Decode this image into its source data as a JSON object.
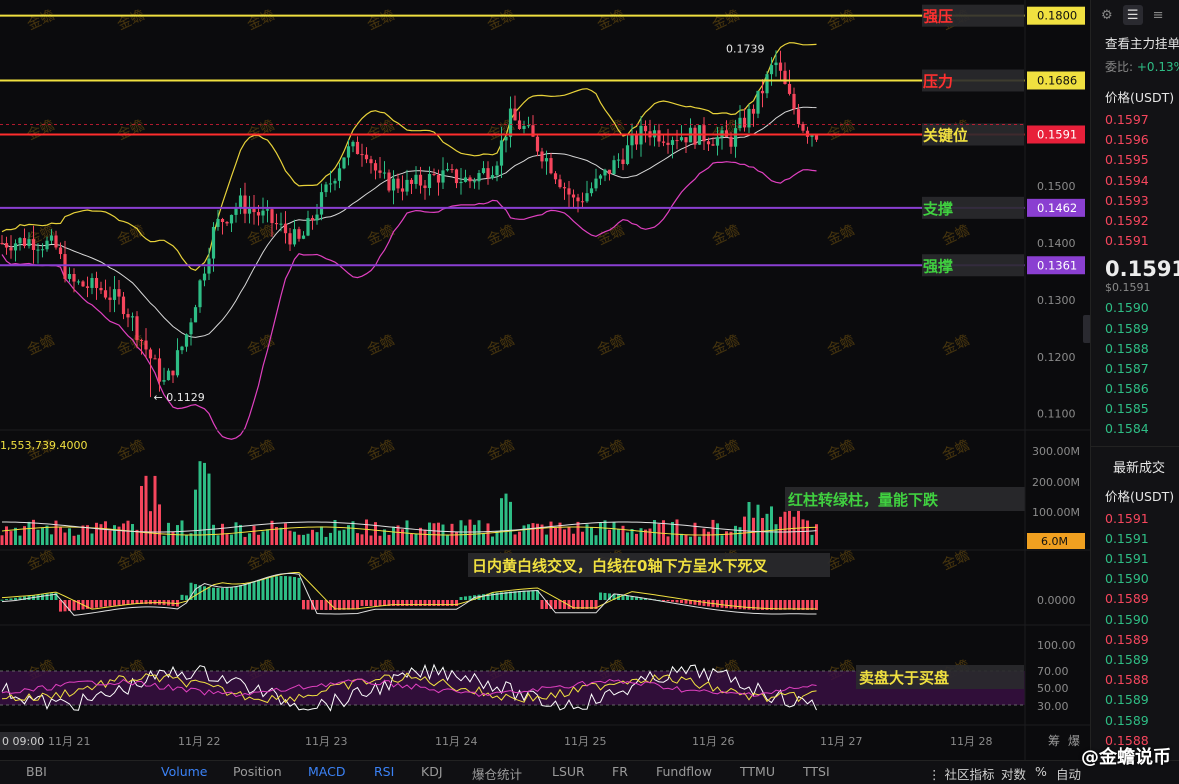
{
  "colors": {
    "up": "#2ebd85",
    "down": "#f6465d",
    "yellow_line": "#f0e040",
    "purple_line": "#8a3fd1",
    "red_line": "#ff2d2d",
    "boll_mid": "#d8d8d8",
    "boll_upper": "#e8d23a",
    "boll_lower": "#e040c0",
    "background": "#0b0b0d",
    "volume_badge": "#f0a020"
  },
  "price_axis": {
    "ticks": [
      "0.1100",
      "0.1200",
      "0.1300",
      "0.1400",
      "0.1500"
    ],
    "range": [
      0.108,
      0.181
    ]
  },
  "levels": [
    {
      "label": "强压",
      "price": "0.1800",
      "label_color": "#ff3030",
      "line": "yellow"
    },
    {
      "label": "压力",
      "price": "0.1686",
      "label_color": "#ff3030",
      "line": "yellow"
    },
    {
      "label": "关键位",
      "price": "0.1591",
      "label_color": "#f0e040",
      "line": "red",
      "current": true,
      "hidden_price": "0.1574"
    },
    {
      "label": "支撑",
      "price": "0.1462",
      "label_color": "#40d040",
      "line": "purple"
    },
    {
      "label": "强撑",
      "price": "0.1361",
      "label_color": "#40d040",
      "line": "purple"
    }
  ],
  "price_markers": {
    "high": "0.1739",
    "low": "0.1129"
  },
  "volume": {
    "readout": "1,553,739.4000",
    "ticks": [
      "300.00M",
      "200.00M",
      "100.00M"
    ],
    "current_badge": "6.0M",
    "annotation": "红柱转绿柱，量能下跌"
  },
  "macd": {
    "zero_label": "0.0000",
    "annotation": "日内黄白线交叉，白线在0轴下方呈水下死叉"
  },
  "rsi": {
    "ticks": [
      "100.00",
      "70.00",
      "50.00",
      "30.00"
    ],
    "annotation": "卖盘大于买盘"
  },
  "time_axis": {
    "start_label": "0 09:00",
    "dates": [
      "11月 21",
      "11月 22",
      "11月 23",
      "11月 24",
      "11月 25",
      "11月 26",
      "11月 27",
      "11月 28"
    ],
    "right_labels": [
      "筹",
      "爆"
    ]
  },
  "watermark": "金蟾",
  "chart_data": {
    "type": "candlestick",
    "title": "",
    "x": [
      "11月 21",
      "11月 22",
      "11月 23",
      "11月 24",
      "11月 25",
      "11月 26",
      "11月 27"
    ],
    "series": [
      {
        "name": "close",
        "values": [
          0.142,
          0.116,
          0.153,
          0.158,
          0.152,
          0.159,
          0.1591
        ]
      },
      {
        "name": "high",
        "values": [
          0.145,
          0.144,
          0.16,
          0.168,
          0.156,
          0.1739,
          0.162
        ]
      },
      {
        "name": "low",
        "values": [
          0.13,
          0.1129,
          0.14,
          0.148,
          0.146,
          0.154,
          0.157
        ]
      }
    ],
    "ylim": [
      0.108,
      0.181
    ],
    "indicators": [
      "BBI",
      "Volume",
      "MACD",
      "RSI"
    ]
  },
  "side": {
    "title": "查看主力挂单",
    "ratio_label": "委比:",
    "ratio_value": "+0.13%",
    "price_header": "价格(USDT)",
    "asks": [
      "0.1597",
      "0.1596",
      "0.1595",
      "0.1594",
      "0.1593",
      "0.1592",
      "0.1591"
    ],
    "last_price": "0.1591",
    "last_price_usd": "$0.1591",
    "bids": [
      "0.1590",
      "0.1589",
      "0.1588",
      "0.1587",
      "0.1586",
      "0.1585",
      "0.1584"
    ],
    "trades_title": "最新成交",
    "trades_header": "价格(USDT)",
    "trades": [
      {
        "p": "0.1591",
        "c": "red"
      },
      {
        "p": "0.1591",
        "c": "green"
      },
      {
        "p": "0.1591",
        "c": "green"
      },
      {
        "p": "0.1590",
        "c": "green"
      },
      {
        "p": "0.1589",
        "c": "red"
      },
      {
        "p": "0.1590",
        "c": "green"
      },
      {
        "p": "0.1589",
        "c": "red"
      },
      {
        "p": "0.1589",
        "c": "green"
      },
      {
        "p": "0.1588",
        "c": "red"
      },
      {
        "p": "0.1589",
        "c": "green"
      },
      {
        "p": "0.1589",
        "c": "green"
      },
      {
        "p": "0.1588",
        "c": "red"
      }
    ]
  },
  "bottom_tabs": [
    {
      "label": "BBI",
      "active": false
    },
    {
      "label": "Volume",
      "active": true
    },
    {
      "label": "Position",
      "active": false
    },
    {
      "label": "MACD",
      "active": true
    },
    {
      "label": "RSI",
      "active": true
    },
    {
      "label": "KDJ",
      "active": false
    },
    {
      "label": "爆仓统计",
      "active": false
    },
    {
      "label": "LSUR",
      "active": false
    },
    {
      "label": "FR",
      "active": false
    },
    {
      "label": "Fundflow",
      "active": false
    },
    {
      "label": "TTMU",
      "active": false
    },
    {
      "label": "TTSI",
      "active": false
    }
  ],
  "bottom_right": {
    "community": "社区指标",
    "compare": "对数",
    "percent": "%",
    "auto": "自动"
  },
  "brand": "@金蟾说币"
}
